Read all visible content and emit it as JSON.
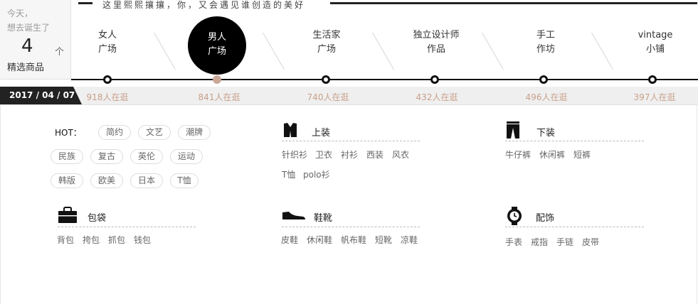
{
  "counter": {
    "line1": "今天，",
    "line2": "想去诞生了",
    "count": "4",
    "unit": "个",
    "label": "精选商品"
  },
  "slogan": "这里熙熙攘攘，你，又会遇见谁创造的美好",
  "categories": [
    {
      "line1": "女人",
      "line2": "广场",
      "visitors": "918人在逛"
    },
    {
      "line1": "男人",
      "line2": "广场",
      "visitors": "841人在逛"
    },
    {
      "line1": "生活家",
      "line2": "广场",
      "visitors": "740人在逛"
    },
    {
      "line1": "独立设计师",
      "line2": "作品",
      "visitors": "432人在逛"
    },
    {
      "line1": "手工",
      "line2": "作坊",
      "visitors": "496人在逛"
    },
    {
      "line1": "vintage",
      "line2": "小铺",
      "visitors": "397人在逛"
    }
  ],
  "date": "2017 / 04 / 07",
  "hot": {
    "label": "HOT：",
    "tags": [
      "简约",
      "文艺",
      "潮牌",
      "民族",
      "复古",
      "英伦",
      "运动",
      "韩版",
      "欧美",
      "日本",
      "T恤"
    ]
  },
  "sections": {
    "tops": {
      "title": "上装",
      "links": [
        "针织衫",
        "卫衣",
        "衬衫",
        "西装",
        "风衣",
        "T恤",
        "polo衫"
      ]
    },
    "bottoms": {
      "title": "下装",
      "links": [
        "牛仔裤",
        "休闲裤",
        "短裤"
      ]
    },
    "bags": {
      "title": "包袋",
      "links": [
        "背包",
        "挎包",
        "抓包",
        "钱包"
      ]
    },
    "shoes": {
      "title": "鞋靴",
      "links": [
        "皮鞋",
        "休闲鞋",
        "帆布鞋",
        "短靴",
        "凉鞋"
      ]
    },
    "accessories": {
      "title": "配饰",
      "links": [
        "手表",
        "戒指",
        "手链",
        "皮带"
      ]
    }
  },
  "colors": {
    "accent": "#c8a08a",
    "active_node": "#caa898",
    "dark": "#111111"
  },
  "icons": {
    "tops": "vest-icon",
    "bottoms": "trousers-icon",
    "bags": "bag-icon",
    "shoes": "shoe-icon",
    "accessories": "watch-icon"
  }
}
